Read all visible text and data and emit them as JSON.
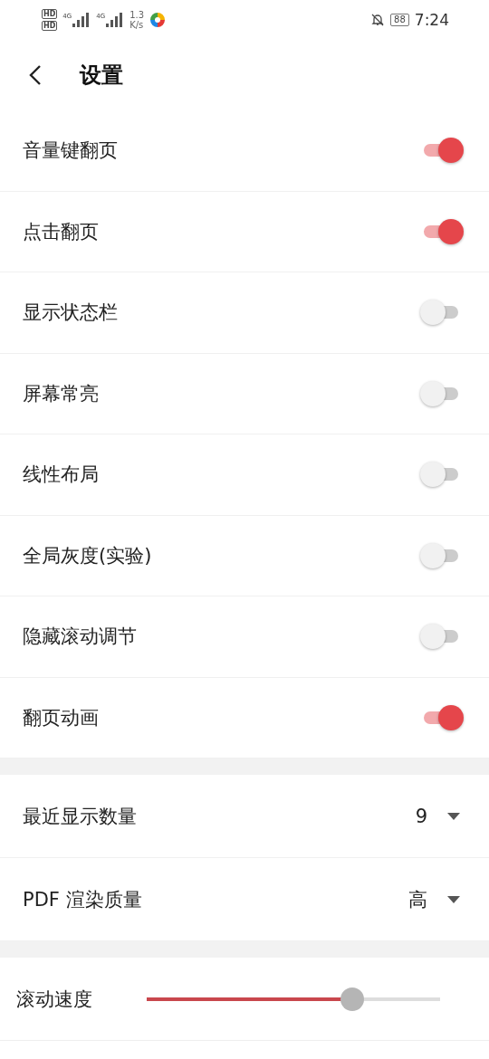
{
  "status_bar": {
    "sim_badges": [
      "HD",
      "HD"
    ],
    "network_labels": [
      "4G",
      "4G"
    ],
    "speed_value": "1.3",
    "speed_unit": "K/s",
    "battery": "88",
    "time": "7:24"
  },
  "header": {
    "title": "设置"
  },
  "toggles": [
    {
      "label": "音量键翻页",
      "on": true
    },
    {
      "label": "点击翻页",
      "on": true
    },
    {
      "label": "显示状态栏",
      "on": false
    },
    {
      "label": "屏幕常亮",
      "on": false
    },
    {
      "label": "线性布局",
      "on": false
    },
    {
      "label": "全局灰度(实验)",
      "on": false
    },
    {
      "label": "隐藏滚动调节",
      "on": false
    },
    {
      "label": "翻页动画",
      "on": true
    }
  ],
  "dropdowns": [
    {
      "label": "最近显示数量",
      "value": "9"
    },
    {
      "label": "PDF 渲染质量",
      "value": "高"
    }
  ],
  "slider": {
    "label": "滚动速度",
    "level": 0.7
  }
}
